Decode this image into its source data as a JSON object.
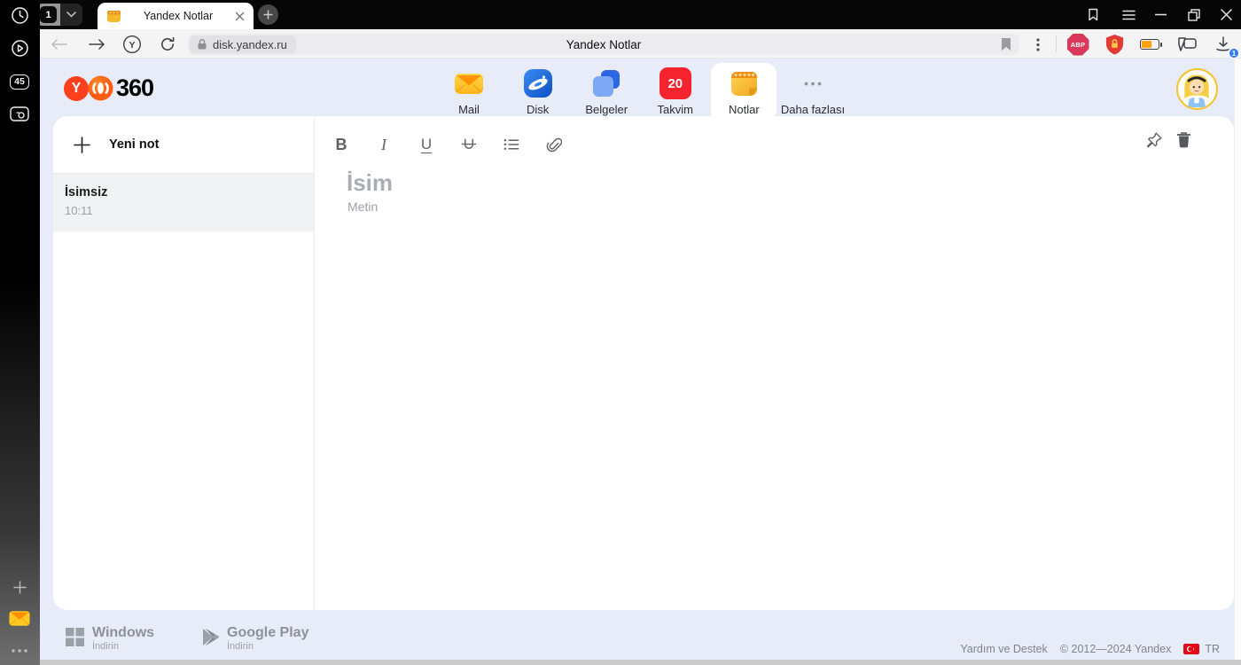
{
  "browser": {
    "tab_group_badge": "1",
    "tab_title": "Yandex Notlar",
    "url": "disk.yandex.ru",
    "page_title": "Yandex Notlar",
    "yandex_letter": "Y",
    "abp_label": "ABP",
    "download_badge": "1"
  },
  "sidebar": {
    "tab_counter": "45"
  },
  "header": {
    "logo_y": "Y",
    "logo_suffix": "360",
    "active_app": "Notlar",
    "apps": [
      {
        "label": "Mail"
      },
      {
        "label": "Disk"
      },
      {
        "label": "Belgeler"
      },
      {
        "label": "Takvim",
        "badge": "20"
      },
      {
        "label": "Notlar"
      },
      {
        "label": "Daha fazlası"
      }
    ]
  },
  "notes_panel": {
    "new_note_label": "Yeni not",
    "notes": [
      {
        "title": "İsimsiz",
        "time": "10:11"
      }
    ]
  },
  "editor": {
    "toolbar": [
      {
        "name": "bold",
        "glyph": "B"
      },
      {
        "name": "italic",
        "glyph": "I"
      },
      {
        "name": "underline",
        "glyph": "U"
      }
    ],
    "title_placeholder": "İsim",
    "body_placeholder": "Metin"
  },
  "footer": {
    "windows_label": "Windows",
    "windows_action": "İndirin",
    "gplay_label": "Google Play",
    "gplay_action": "İndirin",
    "help_label": "Yardım ve Destek",
    "copyright": "© 2012—2024 Yandex",
    "locale": "TR"
  },
  "colors": {
    "yandex_red": "#fc3f1d",
    "header_bg": "#e8ecf8",
    "calendar_red": "#f5232e",
    "notes_yellow": "#f7b92c",
    "badge_blue": "#2f7bf5",
    "abp_red": "#d93a5b"
  }
}
